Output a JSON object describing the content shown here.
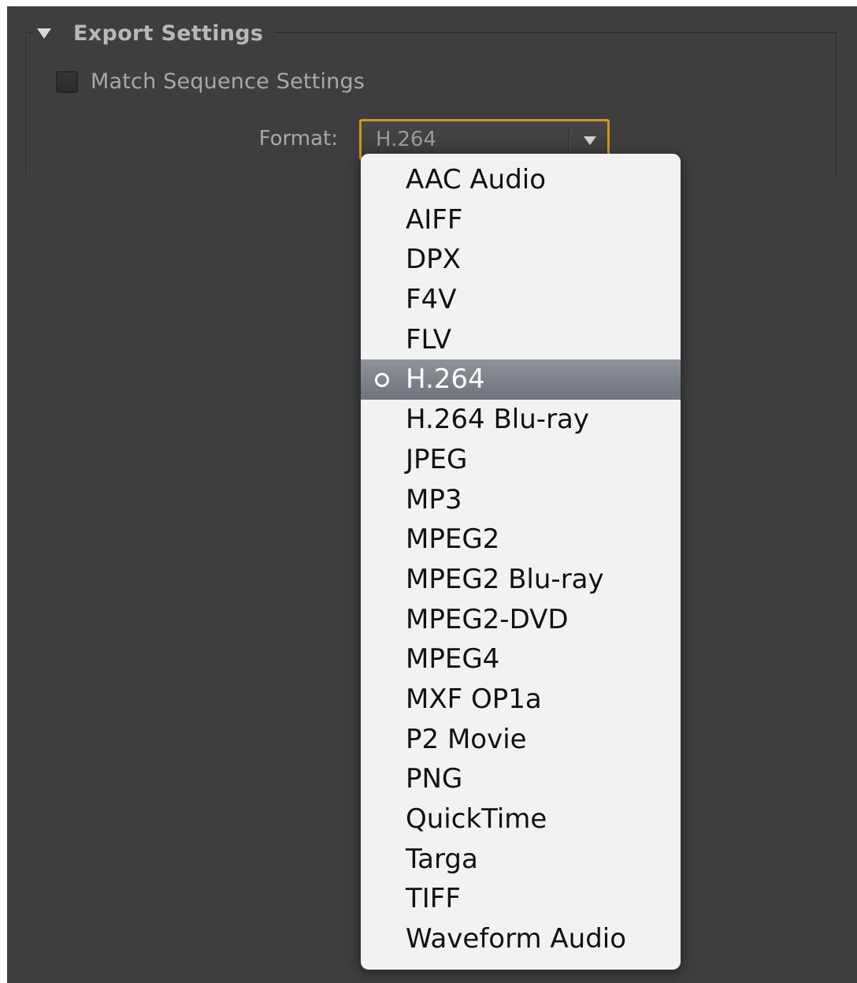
{
  "section": {
    "title": "Export Settings"
  },
  "match_sequence": {
    "label": "Match Sequence Settings",
    "checked": false
  },
  "format": {
    "label": "Format:",
    "selected": "H.264",
    "options": [
      "AAC Audio",
      "AIFF",
      "DPX",
      "F4V",
      "FLV",
      "H.264",
      "H.264 Blu-ray",
      "JPEG",
      "MP3",
      "MPEG2",
      "MPEG2 Blu-ray",
      "MPEG2-DVD",
      "MPEG4",
      "MXF OP1a",
      "P2 Movie",
      "PNG",
      "QuickTime",
      "Targa",
      "TIFF",
      "Waveform Audio"
    ]
  },
  "colors": {
    "panel_bg": "#3e3e3e",
    "focus_ring": "#d7941e",
    "menu_bg": "#f8f8f8",
    "selected_bg": "#7f848c"
  },
  "icons": {
    "disclosure": "triangle-down",
    "dropdown": "chevron-down",
    "selected_marker": "radio-circle"
  }
}
